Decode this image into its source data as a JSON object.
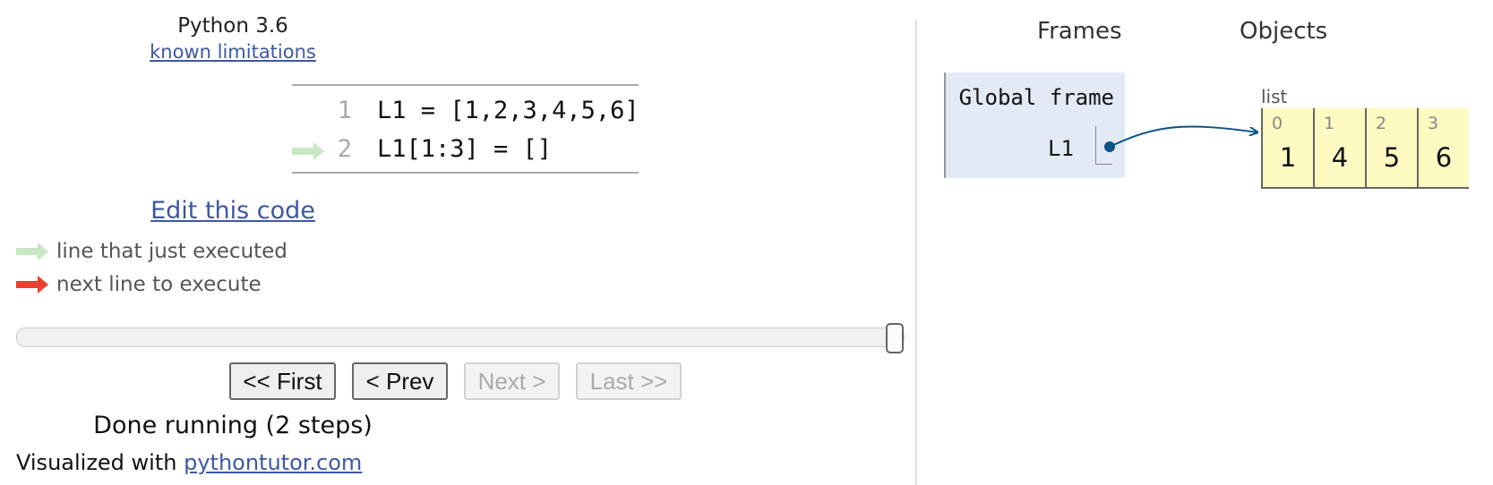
{
  "header": {
    "language": "Python 3.6",
    "limitations_link": "known limitations"
  },
  "code": {
    "lines": [
      {
        "number": "1",
        "text": "L1 = [1,2,3,4,5,6]"
      },
      {
        "number": "2",
        "text": "L1[1:3] = []"
      }
    ],
    "current_line": 2
  },
  "edit_link": "Edit this code",
  "legend": {
    "executed": "line that just executed",
    "next": "next line to execute"
  },
  "slider": {
    "step": 2,
    "total": 2
  },
  "controls": {
    "first": "<< First",
    "prev": "< Prev",
    "next": "Next >",
    "last": "Last >>"
  },
  "status": "Done running (2 steps)",
  "footer": {
    "prefix": "Visualized with ",
    "link": "pythontutor.com"
  },
  "viz": {
    "frames_heading": "Frames",
    "objects_heading": "Objects",
    "global_frame": {
      "title": "Global frame",
      "variables": [
        {
          "name": "L1"
        }
      ]
    },
    "list_object": {
      "label": "list",
      "items": [
        {
          "index": "0",
          "value": "1"
        },
        {
          "index": "1",
          "value": "4"
        },
        {
          "index": "2",
          "value": "5"
        },
        {
          "index": "3",
          "value": "6"
        }
      ]
    }
  },
  "colors": {
    "executed_arrow": "#c9e6c5",
    "next_arrow": "#e8412f",
    "pointer": "#0a5382",
    "frame_bg": "#e2eaf5",
    "list_bg": "#fdfbc1",
    "link": "#3d58a3"
  }
}
